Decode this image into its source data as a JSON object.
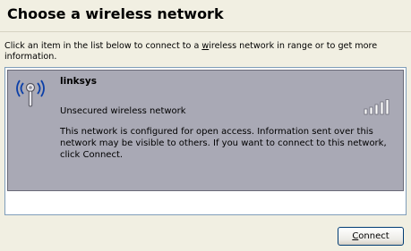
{
  "header": {
    "title": "Choose a wireless network"
  },
  "instructions": {
    "prefix": "Click an item in the list below to connect to a ",
    "underlined": "w",
    "suffix": "ireless network in range or to get more information."
  },
  "networks": [
    {
      "name": "linksys",
      "security": "Unsecured wireless network",
      "description": "This network is configured for open access. Information sent over this network may be visible to others. If you want to connect to this network, click Connect.",
      "signal_bars": 5,
      "selected": true
    }
  ],
  "buttons": {
    "connect_underlined": "C",
    "connect_rest": "onnect"
  },
  "colors": {
    "background": "#f1efe2",
    "selected_item": "#a9a9b5",
    "list_border": "#7f9db9"
  },
  "icons": {
    "network": "wireless-antenna-icon",
    "signal": "signal-strength-icon"
  }
}
